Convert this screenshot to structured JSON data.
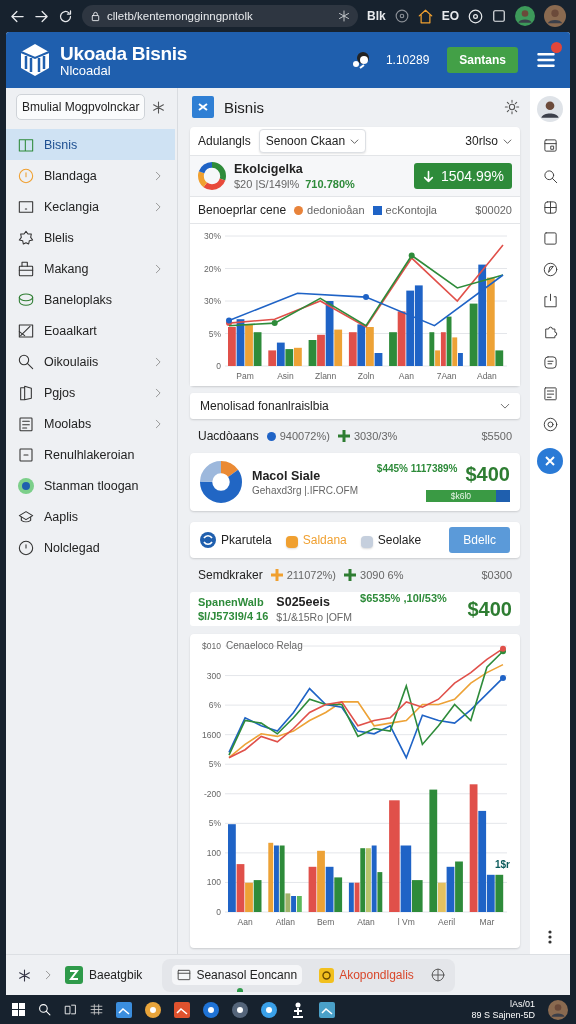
{
  "browser": {
    "url": "clletb/kentemongginngpntolk",
    "toolbar_text": "Blk",
    "extension_text": "EO"
  },
  "app_header": {
    "title": "Ukoada Bisnis",
    "subtitle": "Nlcoadal",
    "reading": "1.10289",
    "button": "Santans",
    "notification_badge": true
  },
  "sidebar": {
    "search_button": "Bmulial Mogpvolnckar",
    "items": [
      {
        "label": "Bisnis",
        "selected": true,
        "has_submenu": false
      },
      {
        "label": "Blandaga",
        "selected": false,
        "has_submenu": true
      },
      {
        "label": "Keclangia",
        "selected": false,
        "has_submenu": true
      },
      {
        "label": "Blelis",
        "selected": false,
        "has_submenu": false
      },
      {
        "label": "Makang",
        "selected": false,
        "has_submenu": true
      },
      {
        "label": "Baneloplaks",
        "selected": false,
        "has_submenu": false
      },
      {
        "label": "Eoaalkart",
        "selected": false,
        "has_submenu": false
      },
      {
        "label": "Oikoulaiis",
        "selected": false,
        "has_submenu": true
      },
      {
        "label": "Pgjos",
        "selected": false,
        "has_submenu": true
      },
      {
        "label": "Moolabs",
        "selected": false,
        "has_submenu": true
      },
      {
        "label": "Renulhlakeroian",
        "selected": false,
        "has_submenu": false
      },
      {
        "label": "Stanman tloogan",
        "selected": false,
        "has_submenu": false
      },
      {
        "label": "Aaplis",
        "selected": false,
        "has_submenu": false
      },
      {
        "label": "Nolclegad",
        "selected": false,
        "has_submenu": false
      }
    ]
  },
  "main": {
    "title": "Bisnis",
    "toolbar": {
      "label": "Adulangls",
      "dropdown": "Senoon Ckaan",
      "period": "30rlso"
    },
    "summary": {
      "name": "Ekolcigelka",
      "amount": "$20 |S/149l%",
      "change": "710.780%",
      "button": "1504.99%"
    },
    "legend": {
      "title": "Benoeprlar cene",
      "items": [
        {
          "label": "dedonioåan",
          "color": "#e8833a",
          "kind": "dot"
        },
        {
          "label": "ecKontojla",
          "color": "#1f63c6",
          "kind": "square"
        }
      ],
      "value": "$00020"
    },
    "chart_1": {
      "y_labels": [
        "30%",
        "20%",
        "30%",
        "5%",
        "0"
      ],
      "x_labels": [
        "Pam",
        "Asin",
        "Zlann",
        "Zoln",
        "Aan",
        "7Aan",
        "Adan"
      ]
    },
    "section": {
      "title": "Menolisad fonanlraislbia",
      "expanded": true
    },
    "stats_row_1": {
      "label": "Uacdòaans",
      "items": [
        {
          "text": "940072%)",
          "color": "#1f63c6",
          "kind": "dot"
        },
        {
          "text": "3030/3%",
          "color": "#2e7d32",
          "kind": "plus"
        }
      ],
      "value": "$5500"
    },
    "sale_card": {
      "name": "Macol Siale",
      "detail": "Gehaxd3rg |.IFRC.OFM",
      "changes": "$445%  1117389%",
      "amount": "$400",
      "bar_label": "$k6l0",
      "level": 0.83
    },
    "filters": {
      "items": [
        {
          "label": "Pkarutela",
          "kind": "logo",
          "selected": false
        },
        {
          "label": "Saldana",
          "kind": "dot",
          "color": "#f0a030",
          "selected": true
        },
        {
          "label": "Seolake",
          "kind": "dot",
          "color": "#c5cfdd",
          "selected": false
        }
      ],
      "button": "Bdellc"
    },
    "stats_row_2": {
      "label": "Semdkraker",
      "items": [
        {
          "text": "211072%)",
          "color": "#f0a030",
          "kind": "plus"
        },
        {
          "text": "3090 6%",
          "color": "#2e7d32",
          "kind": "plus"
        }
      ],
      "value": "$0300"
    },
    "detail_row": {
      "col_1": [
        "SpanenWalb",
        "$l/J573l9/4 16"
      ],
      "col_2": [
        "S025eeis",
        "$1/&15Ro |OFM"
      ],
      "changes": "$6535% ,10l/53%",
      "amount": "$400"
    },
    "chart_2": {
      "title": "Cenaeloco Relag",
      "y_labels": [
        "$010",
        "300",
        "6%",
        "1600",
        "5%",
        "-200",
        "5%",
        "100",
        "100",
        "0"
      ],
      "x_labels": [
        "Aan",
        "Atlan",
        "Bem",
        "Atan",
        "l Vm",
        "Aeril",
        "Mar"
      ],
      "note": "1$r"
    }
  },
  "bottom_bar": {
    "pinned": "Baeatgbik",
    "tabs": [
      {
        "label": "Seanasol Eoncann",
        "selected": true,
        "alert": false
      },
      {
        "label": "Akopondlgalis",
        "selected": false,
        "alert": true
      }
    ]
  },
  "taskbar": {
    "time": "lAs/01",
    "date": "89 S Sajnen-5D"
  }
}
